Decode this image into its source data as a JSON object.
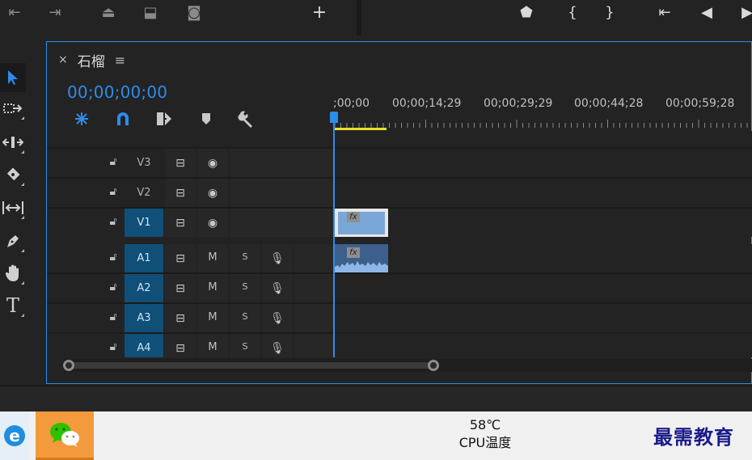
{
  "panel": {
    "close": "×",
    "title": "石榴",
    "menu": "≡"
  },
  "timecode": "00;00;00;00",
  "ruler_labels": [
    ";00;00",
    "00;00;14;29",
    "00;00;29;29",
    "00;00;44;28",
    "00;00;59;28"
  ],
  "tracks": {
    "video": [
      {
        "name": "V3",
        "targeted": false
      },
      {
        "name": "V2",
        "targeted": false
      },
      {
        "name": "V1",
        "targeted": true
      }
    ],
    "audio": [
      {
        "name": "A1",
        "mute": "M",
        "solo": "S"
      },
      {
        "name": "A2",
        "mute": "M",
        "solo": "S"
      },
      {
        "name": "A3",
        "mute": "M",
        "solo": "S"
      },
      {
        "name": "A4",
        "mute": "M",
        "solo": "S"
      }
    ]
  },
  "clip": {
    "fx_badge": "fx"
  },
  "taskbar": {
    "cpu_temp": "58℃",
    "cpu_label": "CPU温度"
  },
  "watermark": "最需教育",
  "colors": {
    "accent": "#2d8ceb",
    "track_selected": "#0f4f78",
    "work_area": "#e8dd2a",
    "clip_video": "#7aa6d8",
    "clip_audio": "#3d5f8c"
  },
  "icons": {
    "top_toolbar": [
      "step-to-start-icon",
      "insert-icon",
      "lift-icon",
      "extract-icon",
      "camera-icon",
      "add-icon",
      "marker-icon",
      "mark-in-icon",
      "mark-out-icon",
      "go-to-in-icon",
      "step-back-icon",
      "play-icon"
    ],
    "tools": [
      "selection-tool-icon",
      "track-select-tool-icon",
      "ripple-edit-tool-icon",
      "razor-tool-icon",
      "slip-tool-icon",
      "pen-tool-icon",
      "hand-tool-icon",
      "type-tool-icon"
    ],
    "timeline_controls": [
      "nest-sequence-icon",
      "snap-magnet-icon",
      "linked-selection-icon",
      "add-marker-icon",
      "timeline-settings-wrench-icon"
    ]
  }
}
